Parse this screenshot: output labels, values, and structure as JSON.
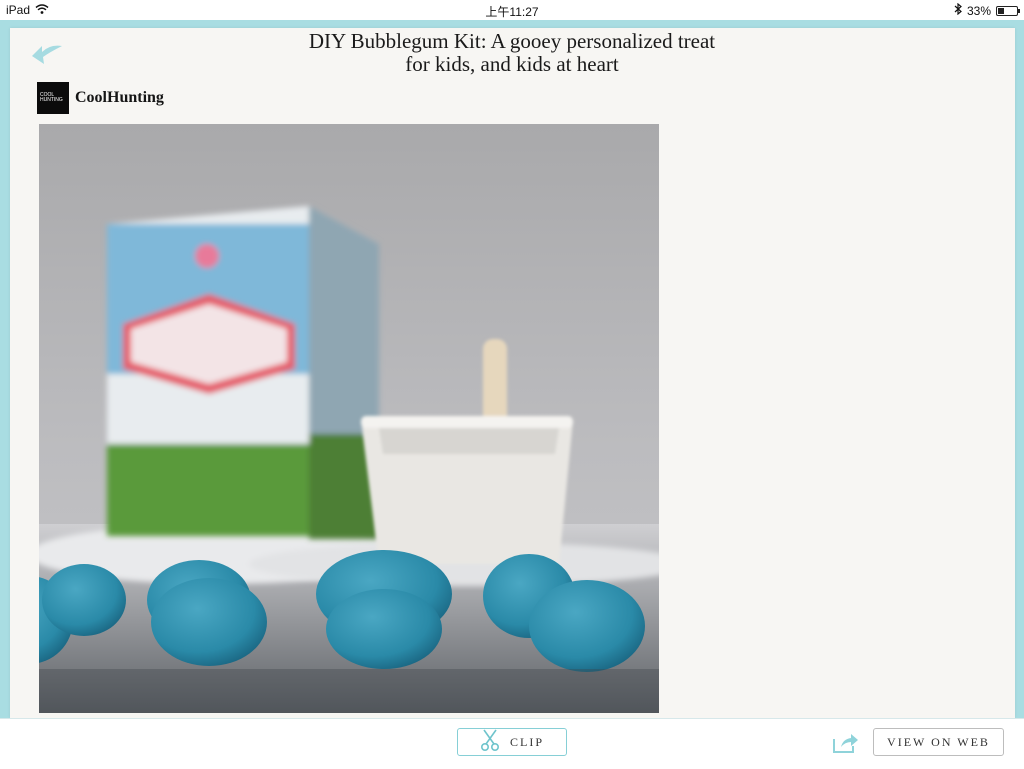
{
  "status_bar": {
    "device": "iPad",
    "time": "上午11:27",
    "battery": "33%",
    "battery_level": 0.33
  },
  "article": {
    "title_line1": "DIY Bubblegum Kit: A gooey personalized treat",
    "title_line2": "for kids, and kids at heart",
    "source_name": "CoolHunting",
    "source_logo_line1": "COOL",
    "source_logo_line2": "HUNTING"
  },
  "toolbar": {
    "clip_label": "CLIP",
    "view_on_web_label": "VIEW ON WEB"
  },
  "icons": {
    "back": "back-arrow-icon",
    "wifi": "wifi-icon",
    "bluetooth": "bluetooth-icon",
    "scissors": "scissors-icon",
    "share": "share-icon"
  },
  "colors": {
    "accent": "#86cfd6",
    "frame": "#a9dde2",
    "paper": "#f7f6f3",
    "gum_blue": "#2a8aa8"
  }
}
